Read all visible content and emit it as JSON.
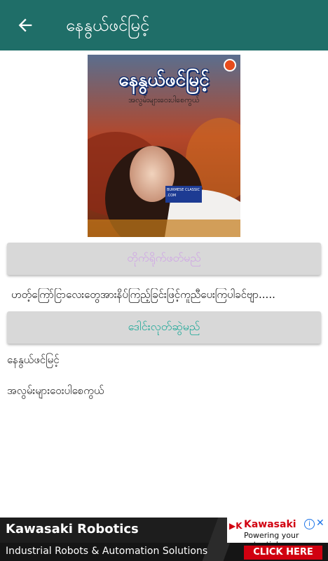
{
  "appbar": {
    "title": "နေနွယ်ဖင်မြင့်",
    "back_icon": "arrow-back-icon",
    "color": "#1f6e68"
  },
  "cover": {
    "title": "နေနွယ်ဖင်မြင့်",
    "subtitle": "အလွမ်းများဝေးပါစေကွယ်",
    "badge": "BURMESE CLASSIC .COM"
  },
  "buttons": {
    "primary_label": "တိုက်ရိုက်ဖတ်မည်",
    "download_label": "ဒေါင်းလုတ်ဆွဲမည်"
  },
  "description": "ဟတ့်ကြော်ငြာလေးတွေအားနိပ်ကြည့်ခြင်းဖြင့်ကူညီပေးကြပါခင်ဗျာ.....",
  "details": {
    "author": "နေနွယ်ဖင်မြင့်",
    "book_title": "အလွမ်းများဝေးပါစေကွယ်"
  },
  "ad": {
    "headline": "Kawasaki Robotics",
    "subline": "Industrial Robots & Automation Solutions",
    "brand": "Kawasaki",
    "tagline": "Powering your potential",
    "cta": "CLICK HERE"
  }
}
